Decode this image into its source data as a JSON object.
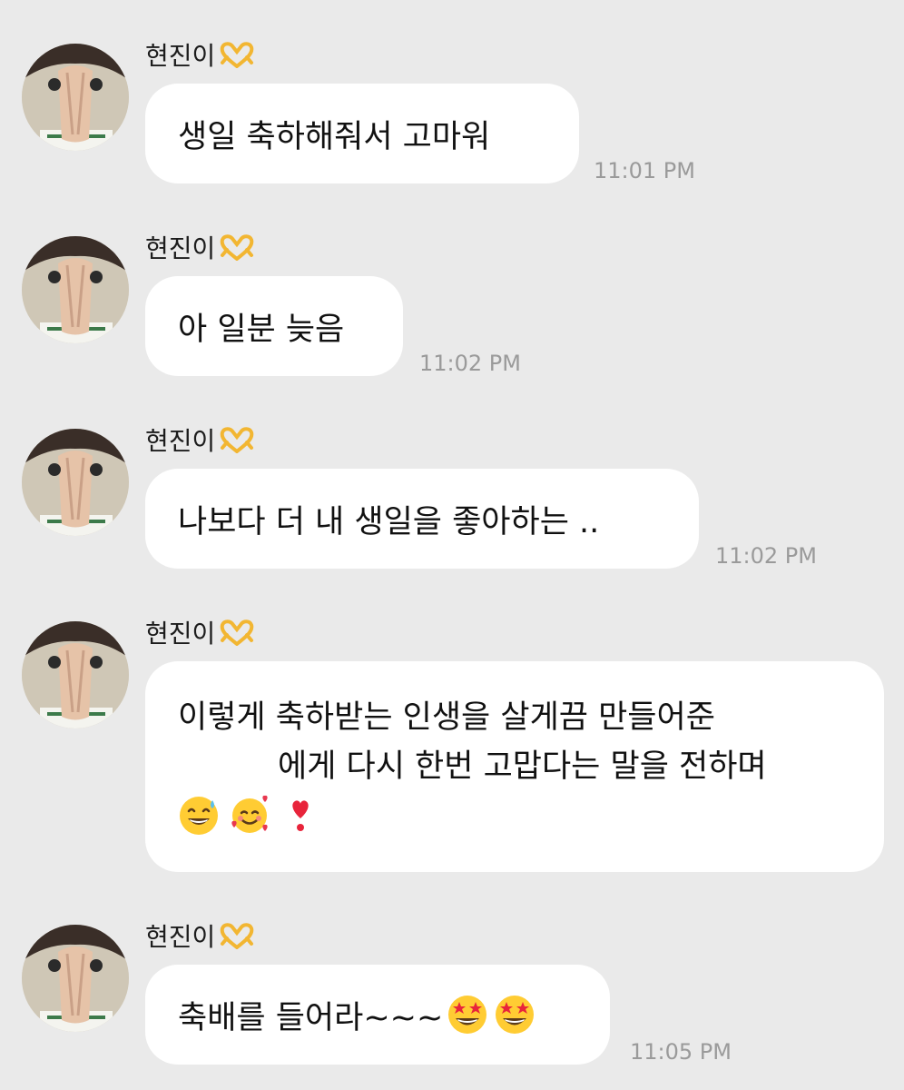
{
  "sender_name": "현진이",
  "messages": [
    {
      "lines": [
        "생일 축하해줘서 고마워"
      ],
      "time": "11:01 PM"
    },
    {
      "lines": [
        "아 일분 늦음"
      ],
      "time": "11:02 PM"
    },
    {
      "lines": [
        "나보다 더 내 생일을 좋아하는 .."
      ],
      "time": "11:02 PM"
    },
    {
      "lines": [
        "이렇게 축하받는 인생을 살게끔 만들어준",
        "에게 다시 한번 고맙다는 말을 전하며"
      ],
      "emojis": [
        "grinning-sweat-emoji",
        "smiling-hearts-emoji",
        "heart-exclamation-emoji"
      ],
      "time": ""
    },
    {
      "lines": [
        "축배를 들어라~~~"
      ],
      "emojis": [
        "star-struck-emoji",
        "star-struck-emoji"
      ],
      "time": "11:05 PM"
    }
  ],
  "colors": {
    "background": "#eaeaea",
    "bubble": "#ffffff",
    "time_text": "#9a9a9a",
    "heart_hands": "#f2b632"
  },
  "icons": {
    "name_badge": "heart-hands-icon",
    "avatar": "profile-avatar"
  }
}
